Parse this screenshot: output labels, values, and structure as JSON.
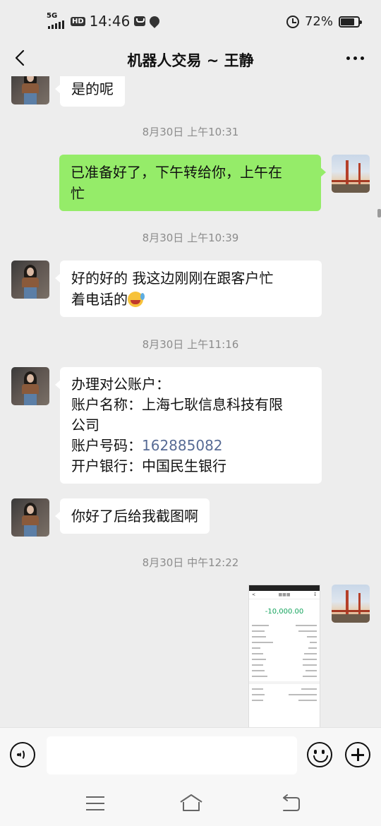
{
  "status_bar": {
    "network": "5G",
    "hd": "HD",
    "time": "14:46",
    "battery": "72%",
    "battery_level": 0.72
  },
  "header": {
    "title": "机器人交易 ~ 王静"
  },
  "messages": [
    {
      "side": "left",
      "lines": [
        "是的呢"
      ]
    },
    {
      "type": "timestamp",
      "text": "8月30日 上午10:31"
    },
    {
      "side": "right",
      "lines": [
        "已准备好了，下午转给你，上午在",
        "忙"
      ]
    },
    {
      "type": "timestamp",
      "text": "8月30日 上午10:39"
    },
    {
      "side": "left",
      "lines": [
        "好的好的  我这边刚刚在跟客户忙",
        "着电话的"
      ],
      "emoji": "crying-laughing-emoji"
    },
    {
      "type": "timestamp",
      "text": "8月30日 上午11:16"
    },
    {
      "side": "left",
      "lines": [
        "办理对公账户：",
        "账户名称：上海七耿信息科技有限",
        "公司",
        "账户号码：",
        "开户银行：中国民生银行"
      ],
      "account_number": "162885082"
    },
    {
      "side": "left",
      "lines": [
        "你好了后给我截图啊"
      ]
    },
    {
      "type": "timestamp",
      "text": "8月30日 中午12:22"
    },
    {
      "side": "right",
      "type": "image",
      "amount": "-10,000.00"
    }
  ],
  "input": {
    "placeholder": ""
  },
  "colors": {
    "sent_bubble": "#95ec69",
    "received_bubble": "#ffffff",
    "background": "#ededed",
    "link": "#576b95",
    "amount": "#13a35c"
  }
}
